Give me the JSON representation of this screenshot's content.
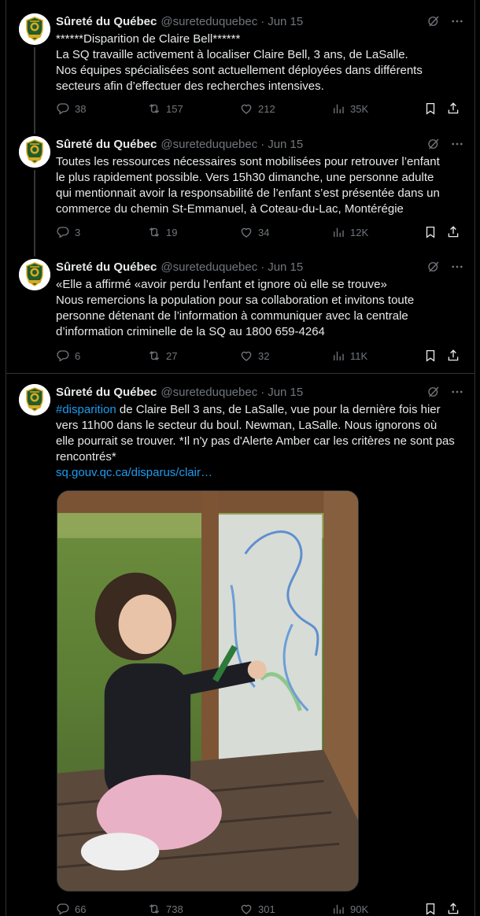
{
  "tweets": [
    {
      "name": "Sûreté du Québec",
      "handle": "@sureteduquebec",
      "date": "Jun 15",
      "lines": [
        "******Disparition de Claire Bell******",
        "La SQ travaille activement à localiser Claire Bell, 3 ans, de LaSalle.",
        "Nos équipes spécialisées sont actuellement déployées dans différents",
        "secteurs afin d’effectuer des recherches intensives."
      ],
      "replies": "38",
      "reposts": "157",
      "likes": "212",
      "views": "35K"
    },
    {
      "name": "Sûreté du Québec",
      "handle": "@sureteduquebec",
      "date": "Jun 15",
      "lines": [
        "Toutes les ressources nécessaires sont mobilisées pour retrouver l’enfant",
        "le plus rapidement possible. Vers 15h30 dimanche, une personne adulte",
        "qui mentionnait avoir la responsabilité de l’enfant s’est présentée dans un",
        "commerce du chemin St-Emmanuel, à Coteau-du-Lac, Montérégie"
      ],
      "replies": "3",
      "reposts": "19",
      "likes": "34",
      "views": "12K"
    },
    {
      "name": "Sûreté du Québec",
      "handle": "@sureteduquebec",
      "date": "Jun 15",
      "lines": [
        "«Elle a affirmé «avoir perdu l’enfant et ignore où elle se trouve»",
        "Nous remercions la population pour sa collaboration et invitons toute",
        "personne détenant de l’information à communiquer avec la centrale",
        "d’information criminelle de la SQ au 1800 659-4264"
      ],
      "replies": "6",
      "reposts": "27",
      "likes": "32",
      "views": "11K"
    },
    {
      "name": "Sûreté du Québec",
      "handle": "@sureteduquebec",
      "date": "Jun 15",
      "hashtag": "#disparition",
      "line1_rest": " de Claire Bell 3 ans, de LaSalle, vue pour la dernière fois hier",
      "lines": [
        "vers 11h00 dans le secteur du boul. Newman, LaSalle.  Nous ignorons où",
        "elle pourrait se trouver. *Il n'y pas d'Alerte Amber car les critères ne sont pas",
        "rencontrés*"
      ],
      "link": "sq.gouv.qc.ca/disparus/clair…",
      "replies": "66",
      "reposts": "738",
      "likes": "301",
      "views": "90K"
    }
  ],
  "colors": {
    "background": "#000000",
    "text": "#e7e9ea",
    "muted": "#71767b",
    "accent": "#1d9bf0",
    "border": "#2f3336"
  },
  "icons": [
    "reply-icon",
    "repost-icon",
    "like-icon",
    "views-icon",
    "bookmark-icon",
    "share-icon",
    "grok-icon",
    "more-icon",
    "sq-badge"
  ]
}
